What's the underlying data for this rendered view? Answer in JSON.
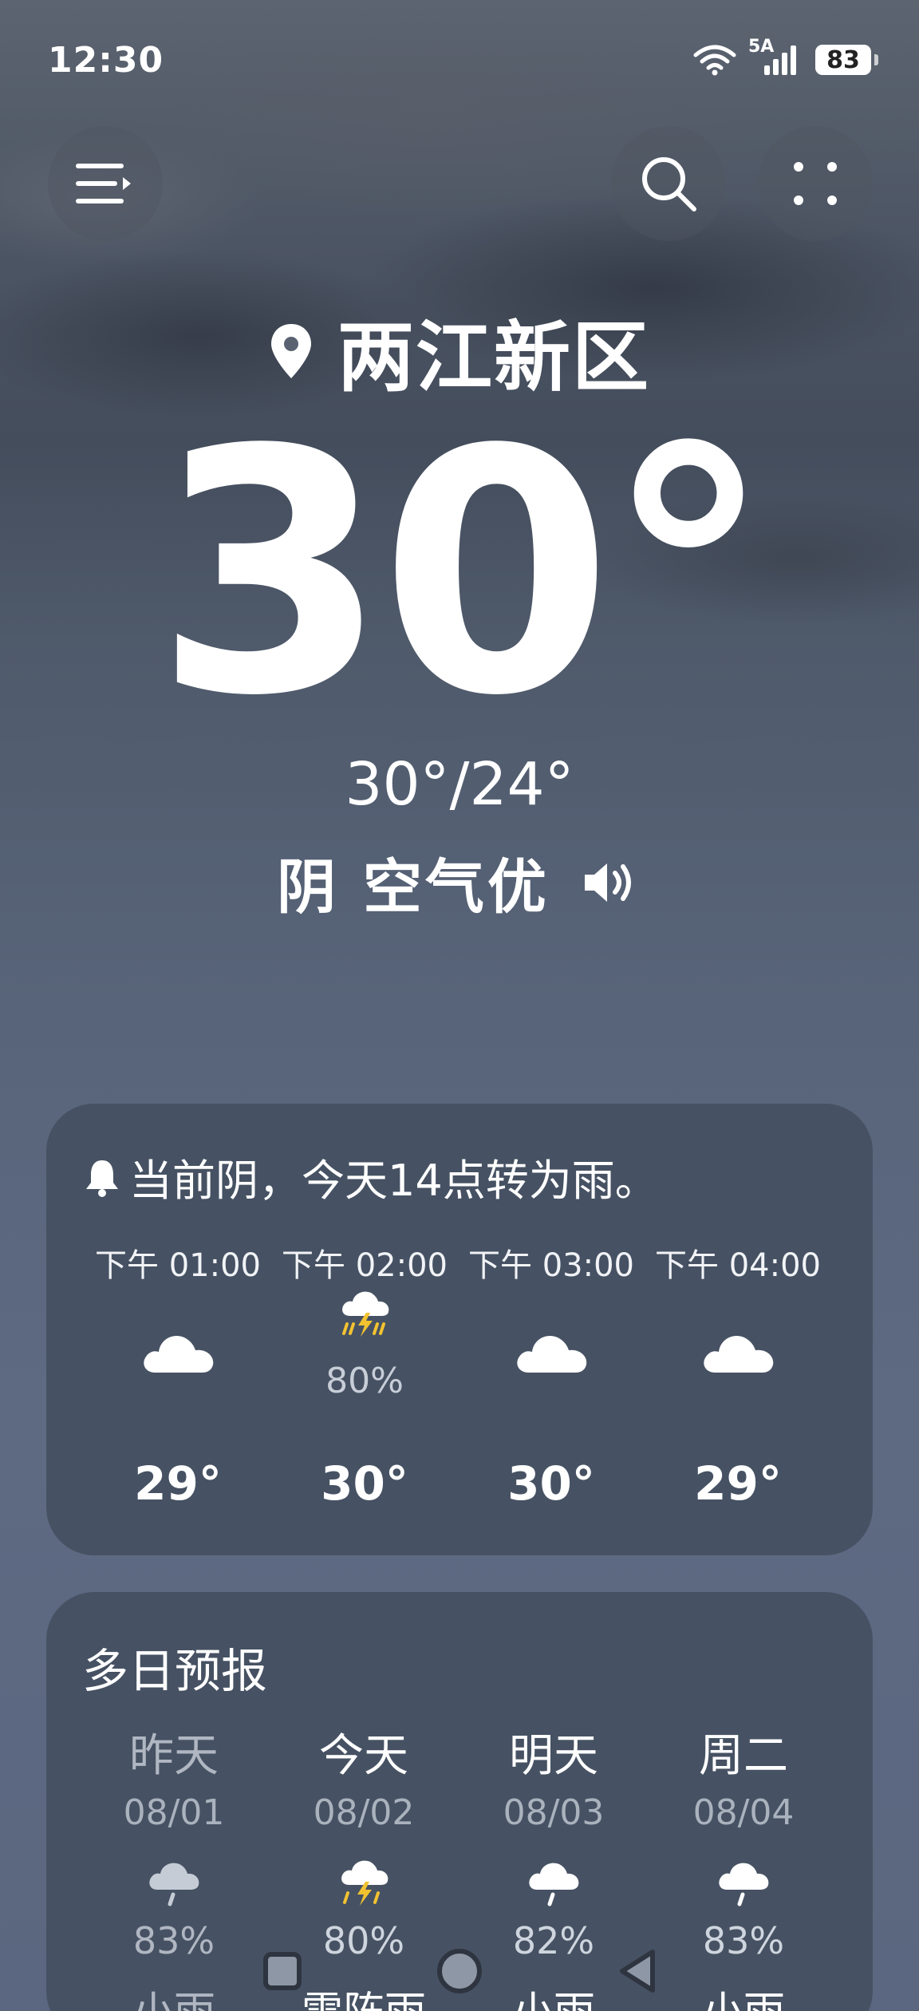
{
  "status_bar": {
    "time": "12:30",
    "network": "5A",
    "battery": "83"
  },
  "location": {
    "name": "两江新区"
  },
  "current": {
    "temperature": "30°",
    "range": "30°/24°",
    "condition": "阴 空气优"
  },
  "hourly": {
    "alert": "当前阴，今天14点转为雨。",
    "items": [
      {
        "time": "下午 01:00",
        "icon": "cloud-icon",
        "pop": "",
        "temp": "29°"
      },
      {
        "time": "下午 02:00",
        "icon": "thunderstorm-icon",
        "pop": "80%",
        "temp": "30°"
      },
      {
        "time": "下午 03:00",
        "icon": "cloud-icon",
        "pop": "",
        "temp": "30°"
      },
      {
        "time": "下午 04:00",
        "icon": "cloud-icon",
        "pop": "",
        "temp": "29°"
      }
    ]
  },
  "daily": {
    "title": "多日预报",
    "items": [
      {
        "day": "昨天",
        "date": "08/01",
        "icon": "light-rain-icon",
        "pop": "83%",
        "condition": "小雨"
      },
      {
        "day": "今天",
        "date": "08/02",
        "icon": "thunderstorm-icon",
        "pop": "80%",
        "condition": "雷阵雨"
      },
      {
        "day": "明天",
        "date": "08/03",
        "icon": "light-rain-icon",
        "pop": "82%",
        "condition": "小雨"
      },
      {
        "day": "周二",
        "date": "08/04",
        "icon": "light-rain-icon",
        "pop": "83%",
        "condition": "小雨"
      }
    ]
  },
  "colors": {
    "card": "#465263",
    "thunder": "#f2c230",
    "text": "#ffffff"
  }
}
